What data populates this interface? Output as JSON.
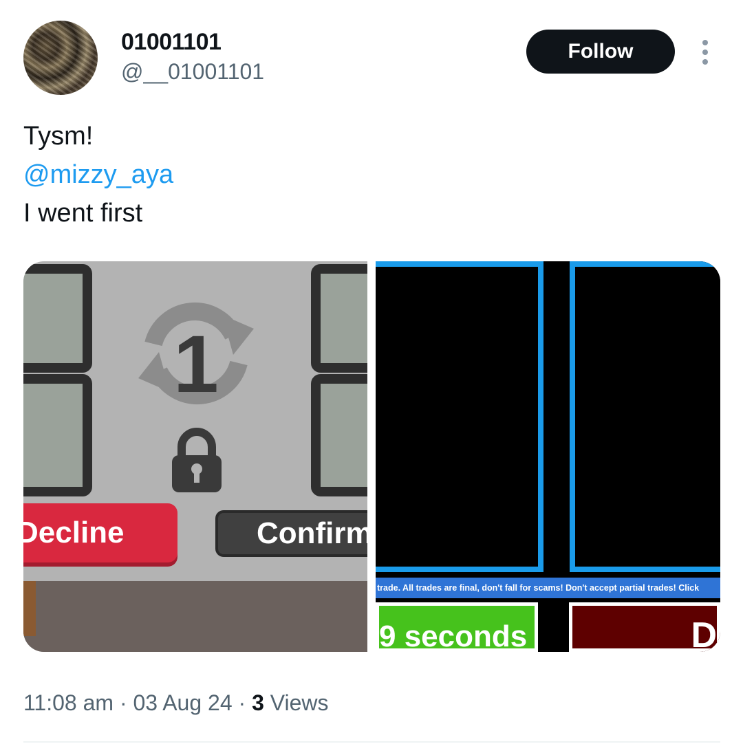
{
  "author": {
    "display_name": "01001101",
    "handle": "@__01001101"
  },
  "actions": {
    "follow_label": "Follow"
  },
  "tweet": {
    "line1": "Tysm!",
    "mention": "@mizzy_aya",
    "line3": "I went first"
  },
  "media": {
    "left": {
      "decline_label": "Decline",
      "confirm_label": "Confirm",
      "trade_count": "1"
    },
    "right": {
      "banner_text": "trade. All trades are final, don't fall for scams! Don't accept partial trades! Click",
      "timer_text": "9 seconds",
      "decline_glyph": "D"
    }
  },
  "meta": {
    "time": "11:08 am",
    "separator": "·",
    "date": "03 Aug 24",
    "views_count": "3",
    "views_label": "Views"
  },
  "colors": {
    "accent": "#1d9bf0",
    "follow_bg": "#0f1419",
    "decline_red": "#d9283f",
    "timer_green": "#46c21c",
    "cell_border_blue": "#1a9bea"
  }
}
